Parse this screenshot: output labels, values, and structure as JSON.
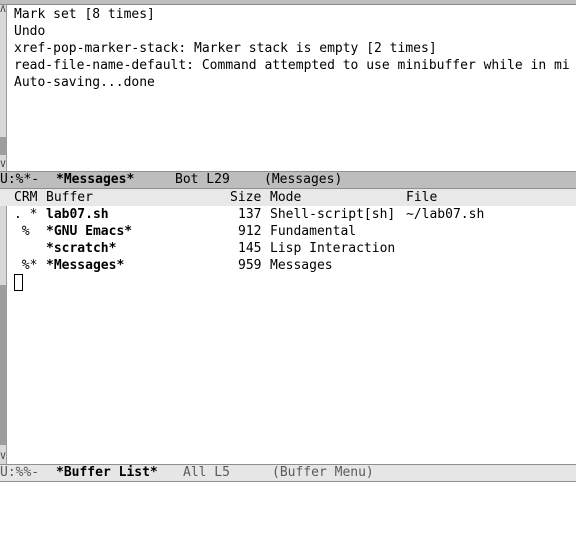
{
  "messages_window": {
    "lines": [
      "Mark set [8 times]",
      "Undo",
      "xref-pop-marker-stack: Marker stack is empty [2 times]",
      "read-file-name-default: Command attempted to use minibuffer while in mi",
      "Auto-saving...done"
    ],
    "modeline": {
      "status": "U:%*-",
      "buffer_name": "*Messages*",
      "position": "Bot L29",
      "mode": "(Messages)"
    }
  },
  "buffer_list": {
    "headers": {
      "crm": "CRM",
      "buffer": "Buffer",
      "size": "Size",
      "mode": "Mode",
      "file": "File"
    },
    "rows": [
      {
        "crm": ". *",
        "name": "lab07.sh",
        "size": "137",
        "mode": "Shell-script[sh]",
        "file": "~/lab07.sh"
      },
      {
        "crm": " %",
        "name": "*GNU Emacs*",
        "size": "912",
        "mode": "Fundamental",
        "file": ""
      },
      {
        "crm": "",
        "name": "*scratch*",
        "size": "145",
        "mode": "Lisp Interaction",
        "file": ""
      },
      {
        "crm": " %*",
        "name": "*Messages*",
        "size": "959",
        "mode": "Messages",
        "file": ""
      }
    ],
    "modeline": {
      "status": "U:%%-",
      "buffer_name": "*Buffer List*",
      "position": "All L5",
      "mode": "(Buffer Menu)"
    }
  },
  "colors": {
    "modeline_active": "#bdbdbd",
    "modeline_inactive": "#e6e6e6",
    "scrollbar": "#d9d9d9"
  }
}
